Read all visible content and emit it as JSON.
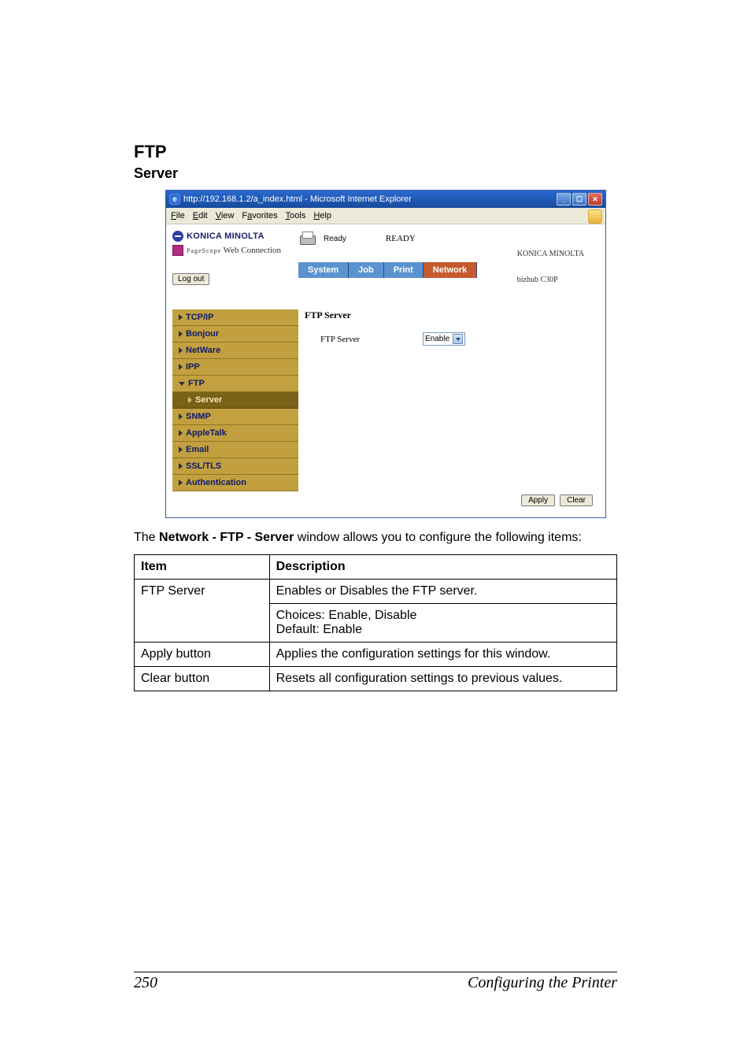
{
  "headings": {
    "ftp": "FTP",
    "server": "Server"
  },
  "ie": {
    "title": "http://192.168.1.2/a_index.html - Microsoft Internet Explorer",
    "menu": [
      "File",
      "Edit",
      "View",
      "Favorites",
      "Tools",
      "Help"
    ],
    "header": {
      "brand": "KONICA MINOLTA",
      "pagescope": "PageScope",
      "webconn": "Web Connection",
      "logout": "Log out",
      "ready_small": "Ready",
      "ready_big": "READY",
      "right1": "KONICA MINOLTA",
      "right2": "bizhub C30P"
    },
    "tabs": {
      "system": "System",
      "job": "Job",
      "print": "Print",
      "network": "Network"
    },
    "sidebar": {
      "tcp": "TCP/IP",
      "bonjour": "Bonjour",
      "netware": "NetWare",
      "ipp": "IPP",
      "ftp": "FTP",
      "ftp_server": "Server",
      "snmp": "SNMP",
      "appletalk": "AppleTalk",
      "email": "Email",
      "ssl": "SSL/TLS",
      "auth": "Authentication"
    },
    "content": {
      "title": "FTP Server",
      "row_label": "FTP Server",
      "select_value": "Enable",
      "apply": "Apply",
      "clear": "Clear"
    }
  },
  "para": {
    "pre": "The ",
    "bold": "Network - FTP - Server",
    "post": " window allows you to configure the following items:"
  },
  "table": {
    "h_item": "Item",
    "h_desc": "Description",
    "rows": [
      {
        "item": "FTP Server",
        "desc_a": "Enables or Disables the FTP server.",
        "desc_b": "Choices: Enable, Disable",
        "desc_c": "Default:  Enable"
      },
      {
        "item": "Apply button",
        "desc": "Applies the configuration settings for this window."
      },
      {
        "item": "Clear button",
        "desc": "Resets all configuration settings to previous values."
      }
    ]
  },
  "footer": {
    "page": "250",
    "section": "Configuring the Printer"
  }
}
